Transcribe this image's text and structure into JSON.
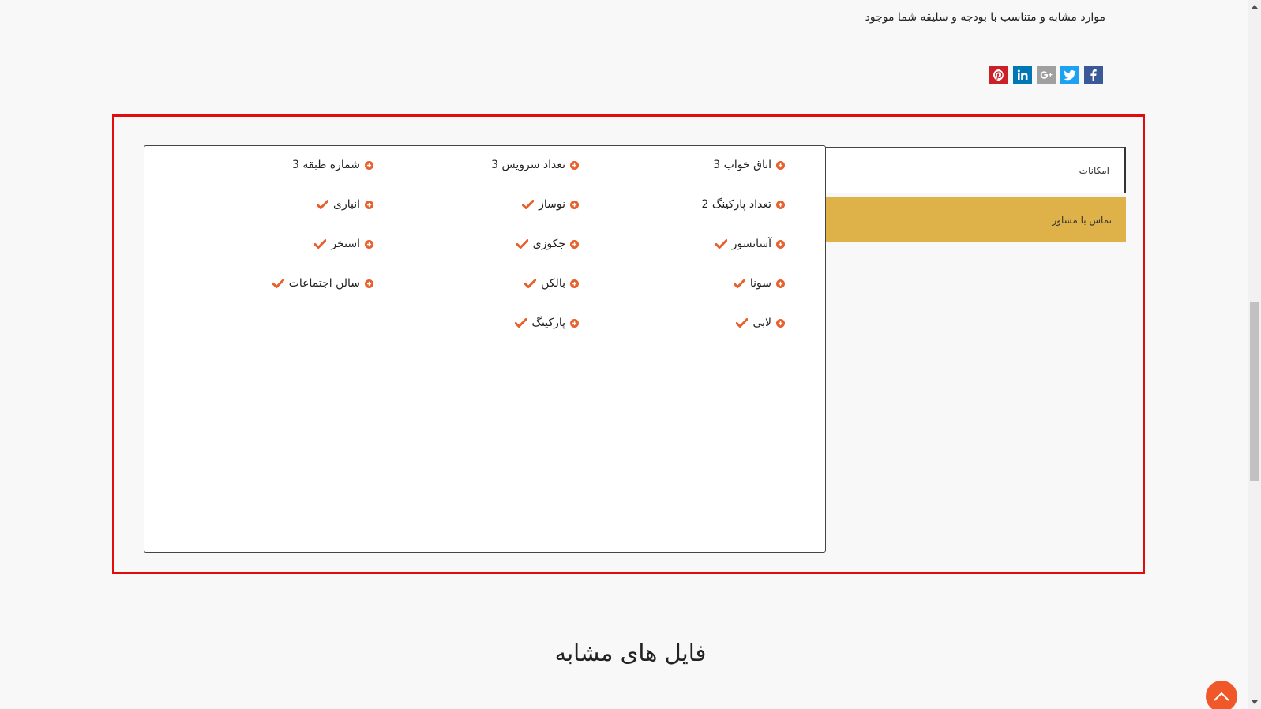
{
  "description": {
    "text": "موارد مشابه و متناسب با بودجه و سلیقه شما موجود"
  },
  "share": {
    "buttons": [
      {
        "icon": "facebook-icon",
        "color": "#3b5998"
      },
      {
        "icon": "twitter-icon",
        "color": "#1da1f2"
      },
      {
        "icon": "google-plus-icon",
        "color": "#a0a0a0"
      },
      {
        "icon": "linkedin-icon",
        "color": "#0077b5"
      },
      {
        "icon": "pinterest-icon",
        "color": "#cb2027"
      }
    ]
  },
  "tabs": {
    "features": "امکانات",
    "contact": "تماس با مشاور"
  },
  "features": {
    "col1": [
      {
        "label": "اتاق خواب 3",
        "checked": false
      },
      {
        "label": "تعداد پارکینگ 2",
        "checked": false
      },
      {
        "label": "آسانسور",
        "checked": true
      },
      {
        "label": "سونا",
        "checked": true
      },
      {
        "label": "لابی",
        "checked": true
      }
    ],
    "col2": [
      {
        "label": "تعداد سرویس 3",
        "checked": false
      },
      {
        "label": "نوساز",
        "checked": true
      },
      {
        "label": "جکوزی",
        "checked": true
      },
      {
        "label": "بالکن",
        "checked": true
      },
      {
        "label": "پارکینگ",
        "checked": true
      }
    ],
    "col3": [
      {
        "label": "شماره طبقه 3",
        "checked": false
      },
      {
        "label": "انباری",
        "checked": true
      },
      {
        "label": "استخر",
        "checked": true
      },
      {
        "label": "سالن اجتماعات",
        "checked": true
      }
    ]
  },
  "similar": {
    "title": "فایل های مشابه"
  },
  "colors": {
    "accent": "#e8602c",
    "tab_active": "#deb248",
    "highlight": "#e10d0d",
    "back_to_top": "#f0582a"
  }
}
